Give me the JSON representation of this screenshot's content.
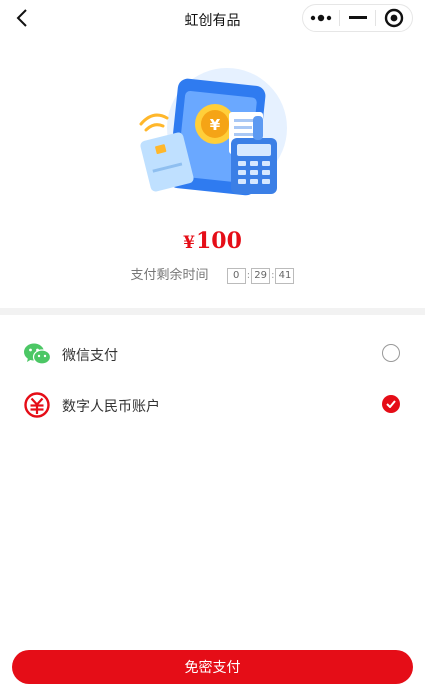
{
  "nav": {
    "title": "虹创有品"
  },
  "payment": {
    "currency": "¥",
    "amount": "100",
    "countdown_label": "支付剩余时间",
    "countdown": {
      "hours": "0",
      "minutes": "29",
      "seconds": "41"
    }
  },
  "methods": [
    {
      "label": "微信支付",
      "icon": "wechat-pay-icon",
      "selected": false
    },
    {
      "label": "数字人民币账户",
      "icon": "digital-rmb-icon",
      "selected": true
    }
  ],
  "submit": {
    "label": "免密支付"
  },
  "colors": {
    "accent": "#e50d17",
    "wechat": "#4cc765",
    "hero_blue": "#2f7bf0"
  }
}
